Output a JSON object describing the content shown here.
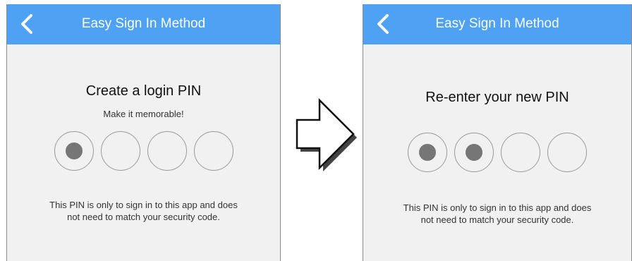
{
  "screens": [
    {
      "title": "Easy Sign In Method",
      "back_icon": "chevron-left-icon",
      "heading": "Create a login PIN",
      "subheading": "Make it memorable!",
      "pin_length": 4,
      "pin_filled": 1,
      "note_line1": "This PIN is only to sign in to this app and does",
      "note_line2": "not need to match your security code."
    },
    {
      "title": "Easy Sign In Method",
      "back_icon": "chevron-left-icon",
      "heading": "Re-enter your new PIN",
      "subheading": "",
      "pin_length": 4,
      "pin_filled": 2,
      "note_line1": "This PIN is only to sign in to this app and does",
      "note_line2": "not need to match your security code."
    }
  ],
  "transition_icon": "right-arrow-icon",
  "colors": {
    "header": "#4ea1f3",
    "background": "#f1f1f1",
    "pin_dot": "#767676",
    "pin_border": "#9a9a9a"
  }
}
